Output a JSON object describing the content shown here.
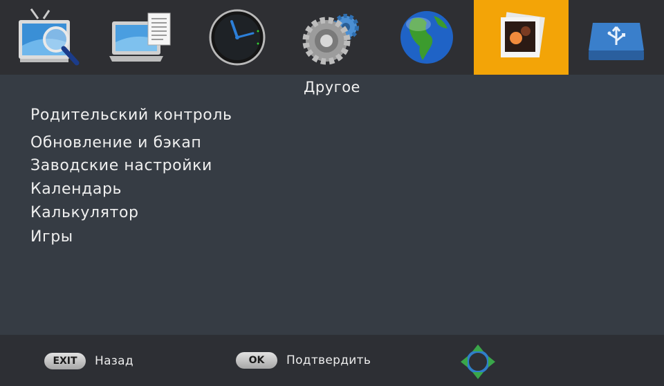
{
  "tabs": [
    {
      "name": "tv-channels-icon"
    },
    {
      "name": "epg-guide-icon"
    },
    {
      "name": "clock-icon"
    },
    {
      "name": "settings-gears-icon"
    },
    {
      "name": "globe-icon"
    },
    {
      "name": "media-photos-icon",
      "active": true
    },
    {
      "name": "usb-drive-icon"
    }
  ],
  "section_title": "Другое",
  "menu_items": [
    "Родительский контроль",
    "Обновление и бэкап",
    "Заводские настройки",
    "Календарь",
    "Калькулятор",
    "Игры"
  ],
  "footer": {
    "exit_key": "EXIT",
    "exit_label": "Назад",
    "ok_key": "OK",
    "ok_label": "Подтвердить",
    "nav_icon": "dpad-navigation-icon"
  },
  "colors": {
    "background": "#363c44",
    "topbar": "#2e2f33",
    "active_tab": "#f3a407",
    "footer": "#2d2f34",
    "text": "#ececec"
  }
}
